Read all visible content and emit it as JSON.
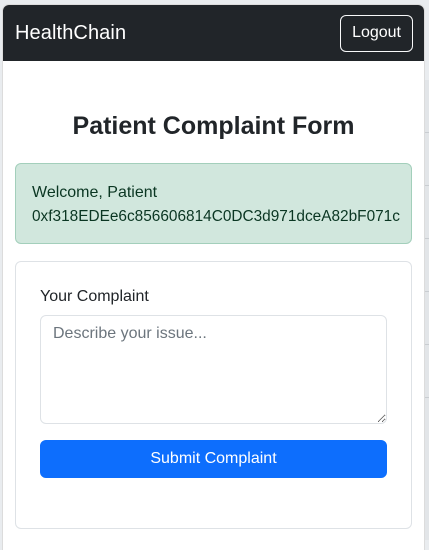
{
  "navbar": {
    "brand": "HealthChain",
    "logout_label": "Logout"
  },
  "page": {
    "title": "Patient Complaint Form"
  },
  "alert": {
    "welcome_text": "Welcome, Patient",
    "address": "0xf318EDEe6c856606814C0DC3d971dceA82bF071c"
  },
  "form": {
    "complaint_label": "Your Complaint",
    "complaint_value": "",
    "complaint_placeholder": "Describe your issue...",
    "submit_label": "Submit Complaint"
  },
  "colors": {
    "navbar_bg": "#212529",
    "alert_bg": "#d1e7dd",
    "alert_text": "#0a3622",
    "primary": "#0d6efd"
  }
}
